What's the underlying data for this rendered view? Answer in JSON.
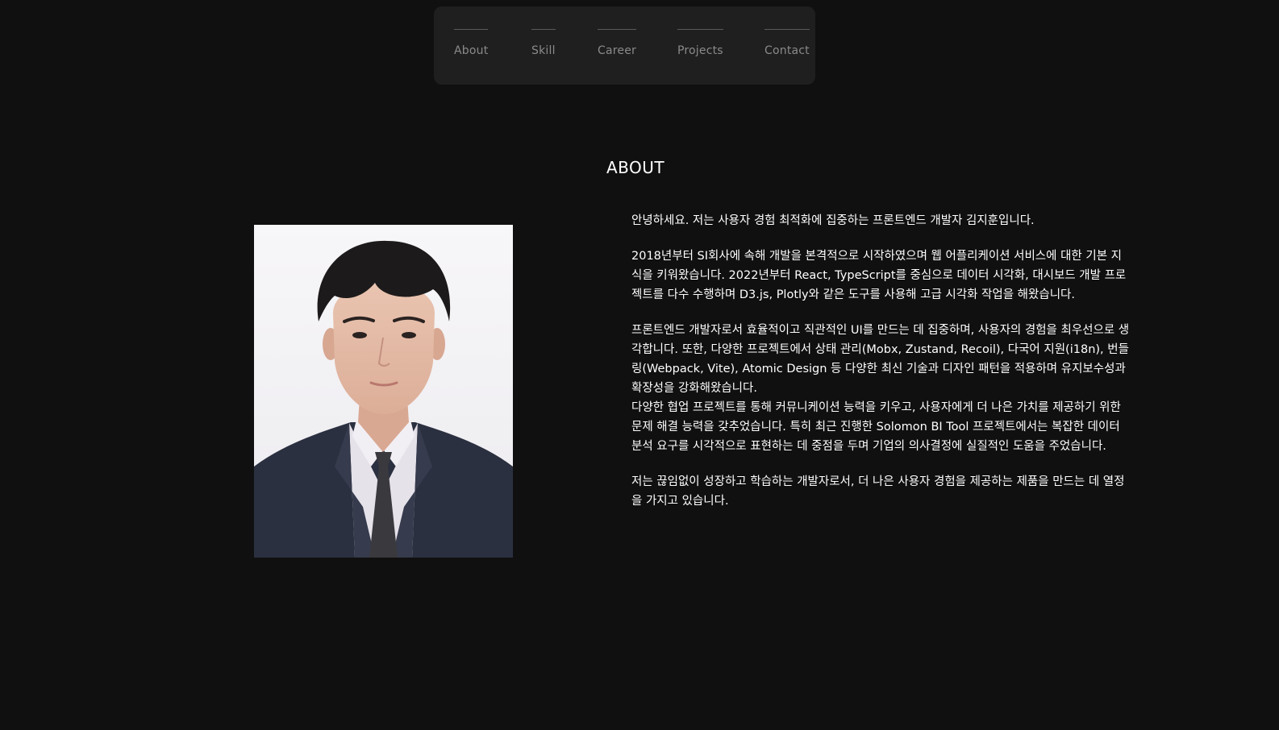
{
  "nav": {
    "items": [
      {
        "label": "About"
      },
      {
        "label": "Skill"
      },
      {
        "label": "Career"
      },
      {
        "label": "Projects"
      },
      {
        "label": "Contact"
      }
    ]
  },
  "about": {
    "title": "ABOUT",
    "paragraphs": [
      "안녕하세요. 저는 사용자 경험 최적화에 집중하는 프론트엔드 개발자 김지훈입니다.",
      "2018년부터 SI회사에 속해 개발을 본격적으로 시작하였으며 웹 어플리케이션 서비스에 대한 기본 지식을 키워왔습니다. 2022년부터 React, TypeScript를 중심으로 데이터 시각화, 대시보드 개발 프로젝트를 다수 수행하며 D3.js, Plotly와 같은 도구를 사용해 고급 시각화 작업을 해왔습니다.",
      "프론트엔드 개발자로서 효율적이고 직관적인 UI를 만드는 데 집중하며, 사용자의 경험을 최우선으로 생각합니다. 또한, 다양한 프로젝트에서 상태 관리(Mobx, Zustand, Recoil), 다국어 지원(i18n), 번들링(Webpack, Vite), Atomic Design 등 다양한 최신 기술과 디자인 패턴을 적용하며 유지보수성과 확장성을 강화해왔습니다.",
      "다양한 협업 프로젝트를 통해 커뮤니케이션 능력을 키우고, 사용자에게 더 나은 가치를 제공하기 위한 문제 해결 능력을 갖추었습니다. 특히 최근 진행한 Solomon BI Tool 프로젝트에서는 복잡한 데이터 분석 요구를 시각적으로 표현하는 데 중점을 두며 기업의 의사결정에 실질적인 도움을 주었습니다.",
      "저는 끊임없이 성장하고 학습하는 개발자로서, 더 나은 사용자 경험을 제공하는 제품을 만드는 데 열정을 가지고 있습니다."
    ]
  },
  "colors": {
    "background": "#101010",
    "nav_background": "#1f1f1f",
    "nav_text": "#8a8a8a",
    "text": "#ffffff"
  }
}
